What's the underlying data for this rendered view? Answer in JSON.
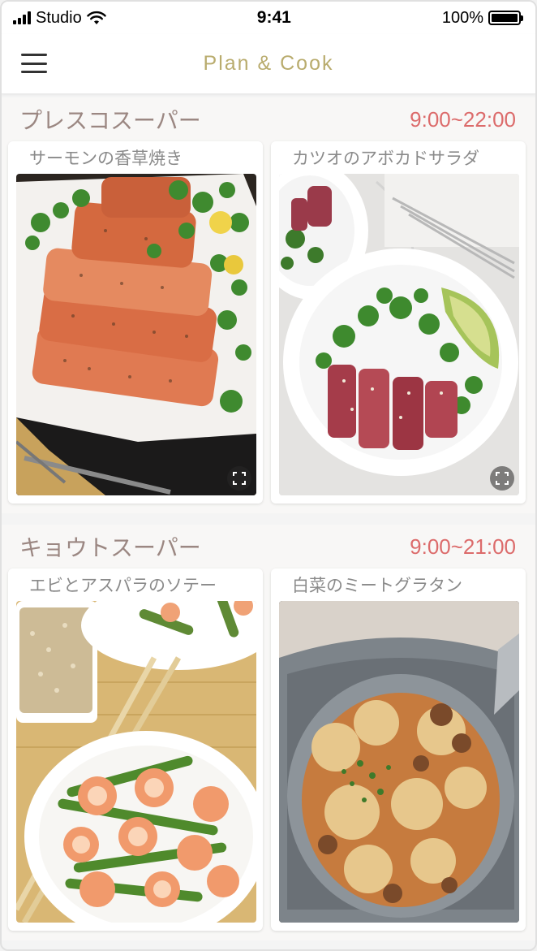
{
  "status_bar": {
    "carrier": "Studio",
    "time": "9:41",
    "battery": "100%",
    "battery_level": 1.0
  },
  "nav": {
    "title": "Plan & Cook",
    "menu_icon": "hamburger-menu-icon"
  },
  "stores": [
    {
      "name": "プレスコスーパー",
      "hours": "9:00~22:00",
      "recipes": [
        {
          "title": "サーモンの香草焼き",
          "image": "salmon-herb-dish"
        },
        {
          "title": "カツオのアボカドサラダ",
          "image": "bonito-avocado-salad"
        }
      ]
    },
    {
      "name": "キョウトスーパー",
      "hours": "9:00~21:00",
      "recipes": [
        {
          "title": "エビとアスパラのソテー",
          "image": "shrimp-asparagus-saute"
        },
        {
          "title": "白菜のミートグラタン",
          "image": "cabbage-meat-gratin"
        }
      ]
    }
  ],
  "colors": {
    "title_gold": "#b9ac6e",
    "store_name": "#9b8782",
    "hours_red": "#dc6b6b",
    "card_title": "#8a8a8a"
  }
}
